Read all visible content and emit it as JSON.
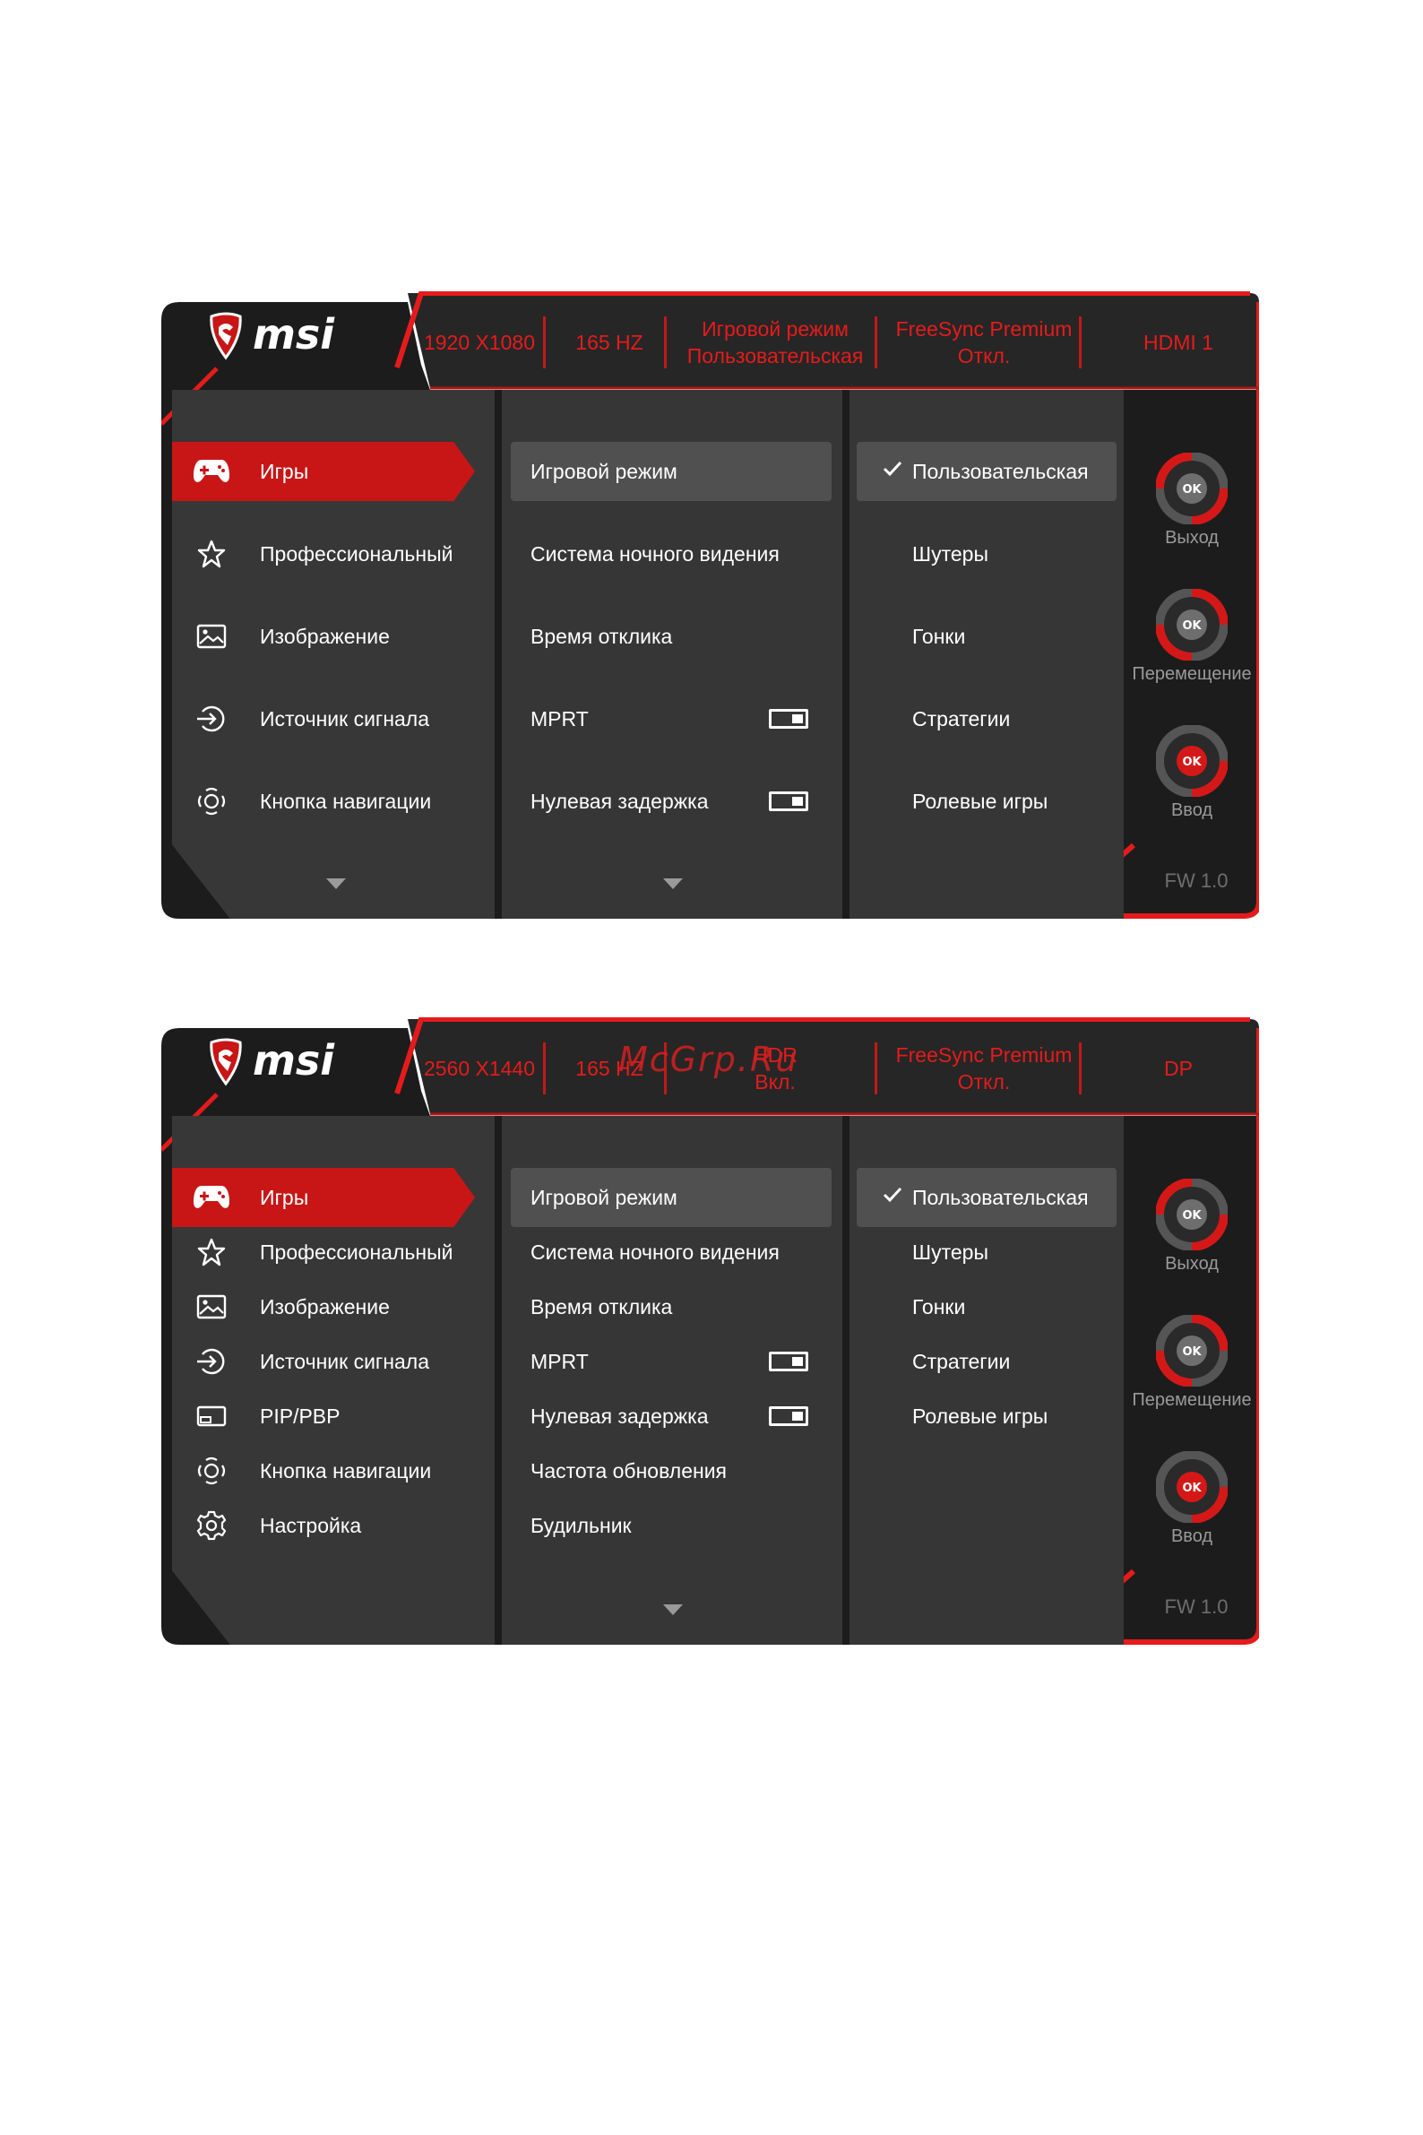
{
  "brand": {
    "name": "msi",
    "accent": "#e51b1b",
    "dark": "#1c1c1c",
    "panel": "#373737"
  },
  "osd1": {
    "status": [
      {
        "line1": "1920 X1080",
        "line2": ""
      },
      {
        "line1": "165 HZ",
        "line2": ""
      },
      {
        "line1": "Игровой режим",
        "line2": "Пользовательская"
      },
      {
        "line1": "FreeSync Premium",
        "line2": "Откл."
      },
      {
        "line1": "HDMI 1",
        "line2": ""
      }
    ],
    "nav": [
      {
        "label": "Игры",
        "icon": "gamepad-icon",
        "active": true
      },
      {
        "label": "Профессиональный",
        "icon": "star-icon"
      },
      {
        "label": "Изображение",
        "icon": "image-icon"
      },
      {
        "label": "Источник сигнала",
        "icon": "input-source-icon"
      },
      {
        "label": "Кнопка навигации",
        "icon": "navi-key-icon"
      }
    ],
    "items": [
      {
        "label": "Игровой режим",
        "selected": true
      },
      {
        "label": "Система ночного видения"
      },
      {
        "label": "Время отклика"
      },
      {
        "label": "MPRT",
        "toggle": true
      },
      {
        "label": "Нулевая задержка",
        "toggle": true
      }
    ],
    "options": [
      {
        "label": "Пользовательская",
        "checked": true
      },
      {
        "label": "Шутеры"
      },
      {
        "label": "Гонки"
      },
      {
        "label": "Стратегии"
      },
      {
        "label": "Ролевые игры"
      }
    ],
    "controls": [
      {
        "label": "Выход",
        "key": "OK"
      },
      {
        "label": "Перемещение",
        "key": "OK"
      },
      {
        "label": "Ввод",
        "key": "OK"
      }
    ],
    "firmware": "FW 1.0"
  },
  "osd2": {
    "status": [
      {
        "line1": "2560 X1440",
        "line2": ""
      },
      {
        "line1": "165 HZ",
        "line2": ""
      },
      {
        "line1": "HDR",
        "line2": "Вкл."
      },
      {
        "line1": "FreeSync Premium",
        "line2": "Откл."
      },
      {
        "line1": "DP",
        "line2": ""
      }
    ],
    "nav": [
      {
        "label": "Игры",
        "icon": "gamepad-icon",
        "active": true
      },
      {
        "label": "Профессиональный",
        "icon": "star-icon"
      },
      {
        "label": "Изображение",
        "icon": "image-icon"
      },
      {
        "label": "Источник сигнала",
        "icon": "input-source-icon"
      },
      {
        "label": "PIP/PBP",
        "icon": "pip-icon"
      },
      {
        "label": "Кнопка навигации",
        "icon": "navi-key-icon"
      },
      {
        "label": "Настройка",
        "icon": "gear-icon"
      }
    ],
    "items": [
      {
        "label": "Игровой режим",
        "selected": true
      },
      {
        "label": "Система ночного видения"
      },
      {
        "label": "Время отклика"
      },
      {
        "label": "MPRT",
        "toggle": true
      },
      {
        "label": "Нулевая задержка",
        "toggle": true
      },
      {
        "label": "Частота обновления"
      },
      {
        "label": "Будильник"
      }
    ],
    "options": [
      {
        "label": "Пользовательская",
        "checked": true
      },
      {
        "label": "Шутеры"
      },
      {
        "label": "Гонки"
      },
      {
        "label": "Стратегии"
      },
      {
        "label": "Ролевые игры"
      }
    ],
    "controls": [
      {
        "label": "Выход",
        "key": "OK"
      },
      {
        "label": "Перемещение",
        "key": "OK"
      },
      {
        "label": "Ввод",
        "key": "OK"
      }
    ],
    "firmware": "FW 1.0"
  },
  "watermark": "McGrp.Ru"
}
